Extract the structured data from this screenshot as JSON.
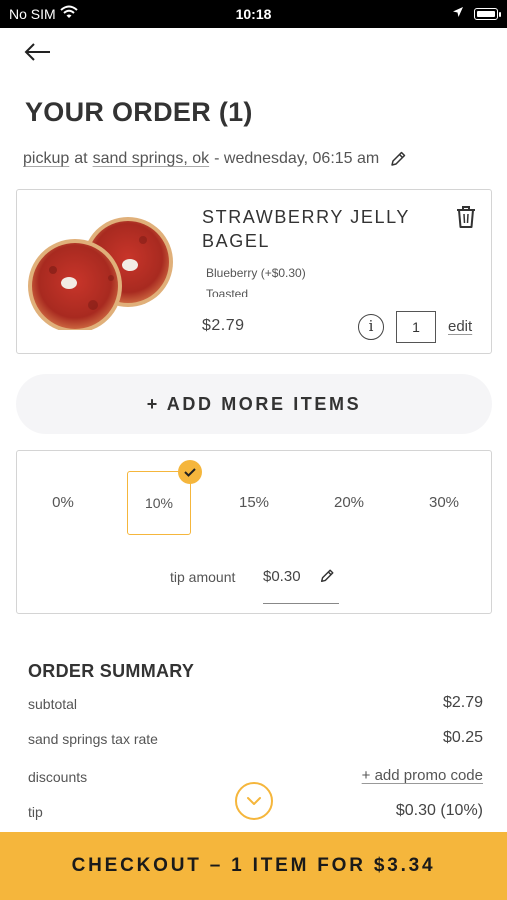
{
  "status_bar": {
    "carrier": "No SIM",
    "time": "10:18"
  },
  "header": {
    "back_icon": "arrow-left-icon",
    "title": "YOUR ORDER (1)"
  },
  "order_info": {
    "mode": "pickup",
    "at": "at",
    "location": "sand springs, ok",
    "time": "- wednesday, 06:15 am",
    "edit_icon": "pencil-icon"
  },
  "cart_item": {
    "name": "STRAWBERRY JELLY BAGEL",
    "modifiers": [
      "Blueberry (+$0.30)",
      "Toasted"
    ],
    "price": "$2.79",
    "quantity": "1",
    "info_label": "i",
    "edit_label": "edit",
    "delete_icon": "trash-icon",
    "image_icon": "bagel-image"
  },
  "add_more_label": "+ ADD MORE ITEMS",
  "tip": {
    "options": [
      "0%",
      "10%",
      "15%",
      "20%",
      "30%"
    ],
    "selected": "10%",
    "amount_label": "tip amount",
    "amount_value": "$0.30",
    "check_icon": "checkmark-icon",
    "edit_icon": "pencil-icon"
  },
  "summary": {
    "title": "ORDER SUMMARY",
    "rows": [
      {
        "label": "subtotal",
        "value": "$2.79"
      },
      {
        "label": "sand springs tax rate",
        "value": "$0.25"
      },
      {
        "label": "discounts",
        "value": "+ add promo code"
      },
      {
        "label": "tip",
        "value": "$0.30 (10%)"
      }
    ]
  },
  "scroll_icon": "chevron-down-icon",
  "checkout_label": "CHECKOUT – 1 ITEM FOR $3.34",
  "colors": {
    "accent": "#f5b63c",
    "text": "#333333",
    "border": "#d4d4d4",
    "button_bg": "#f5f5f7"
  }
}
